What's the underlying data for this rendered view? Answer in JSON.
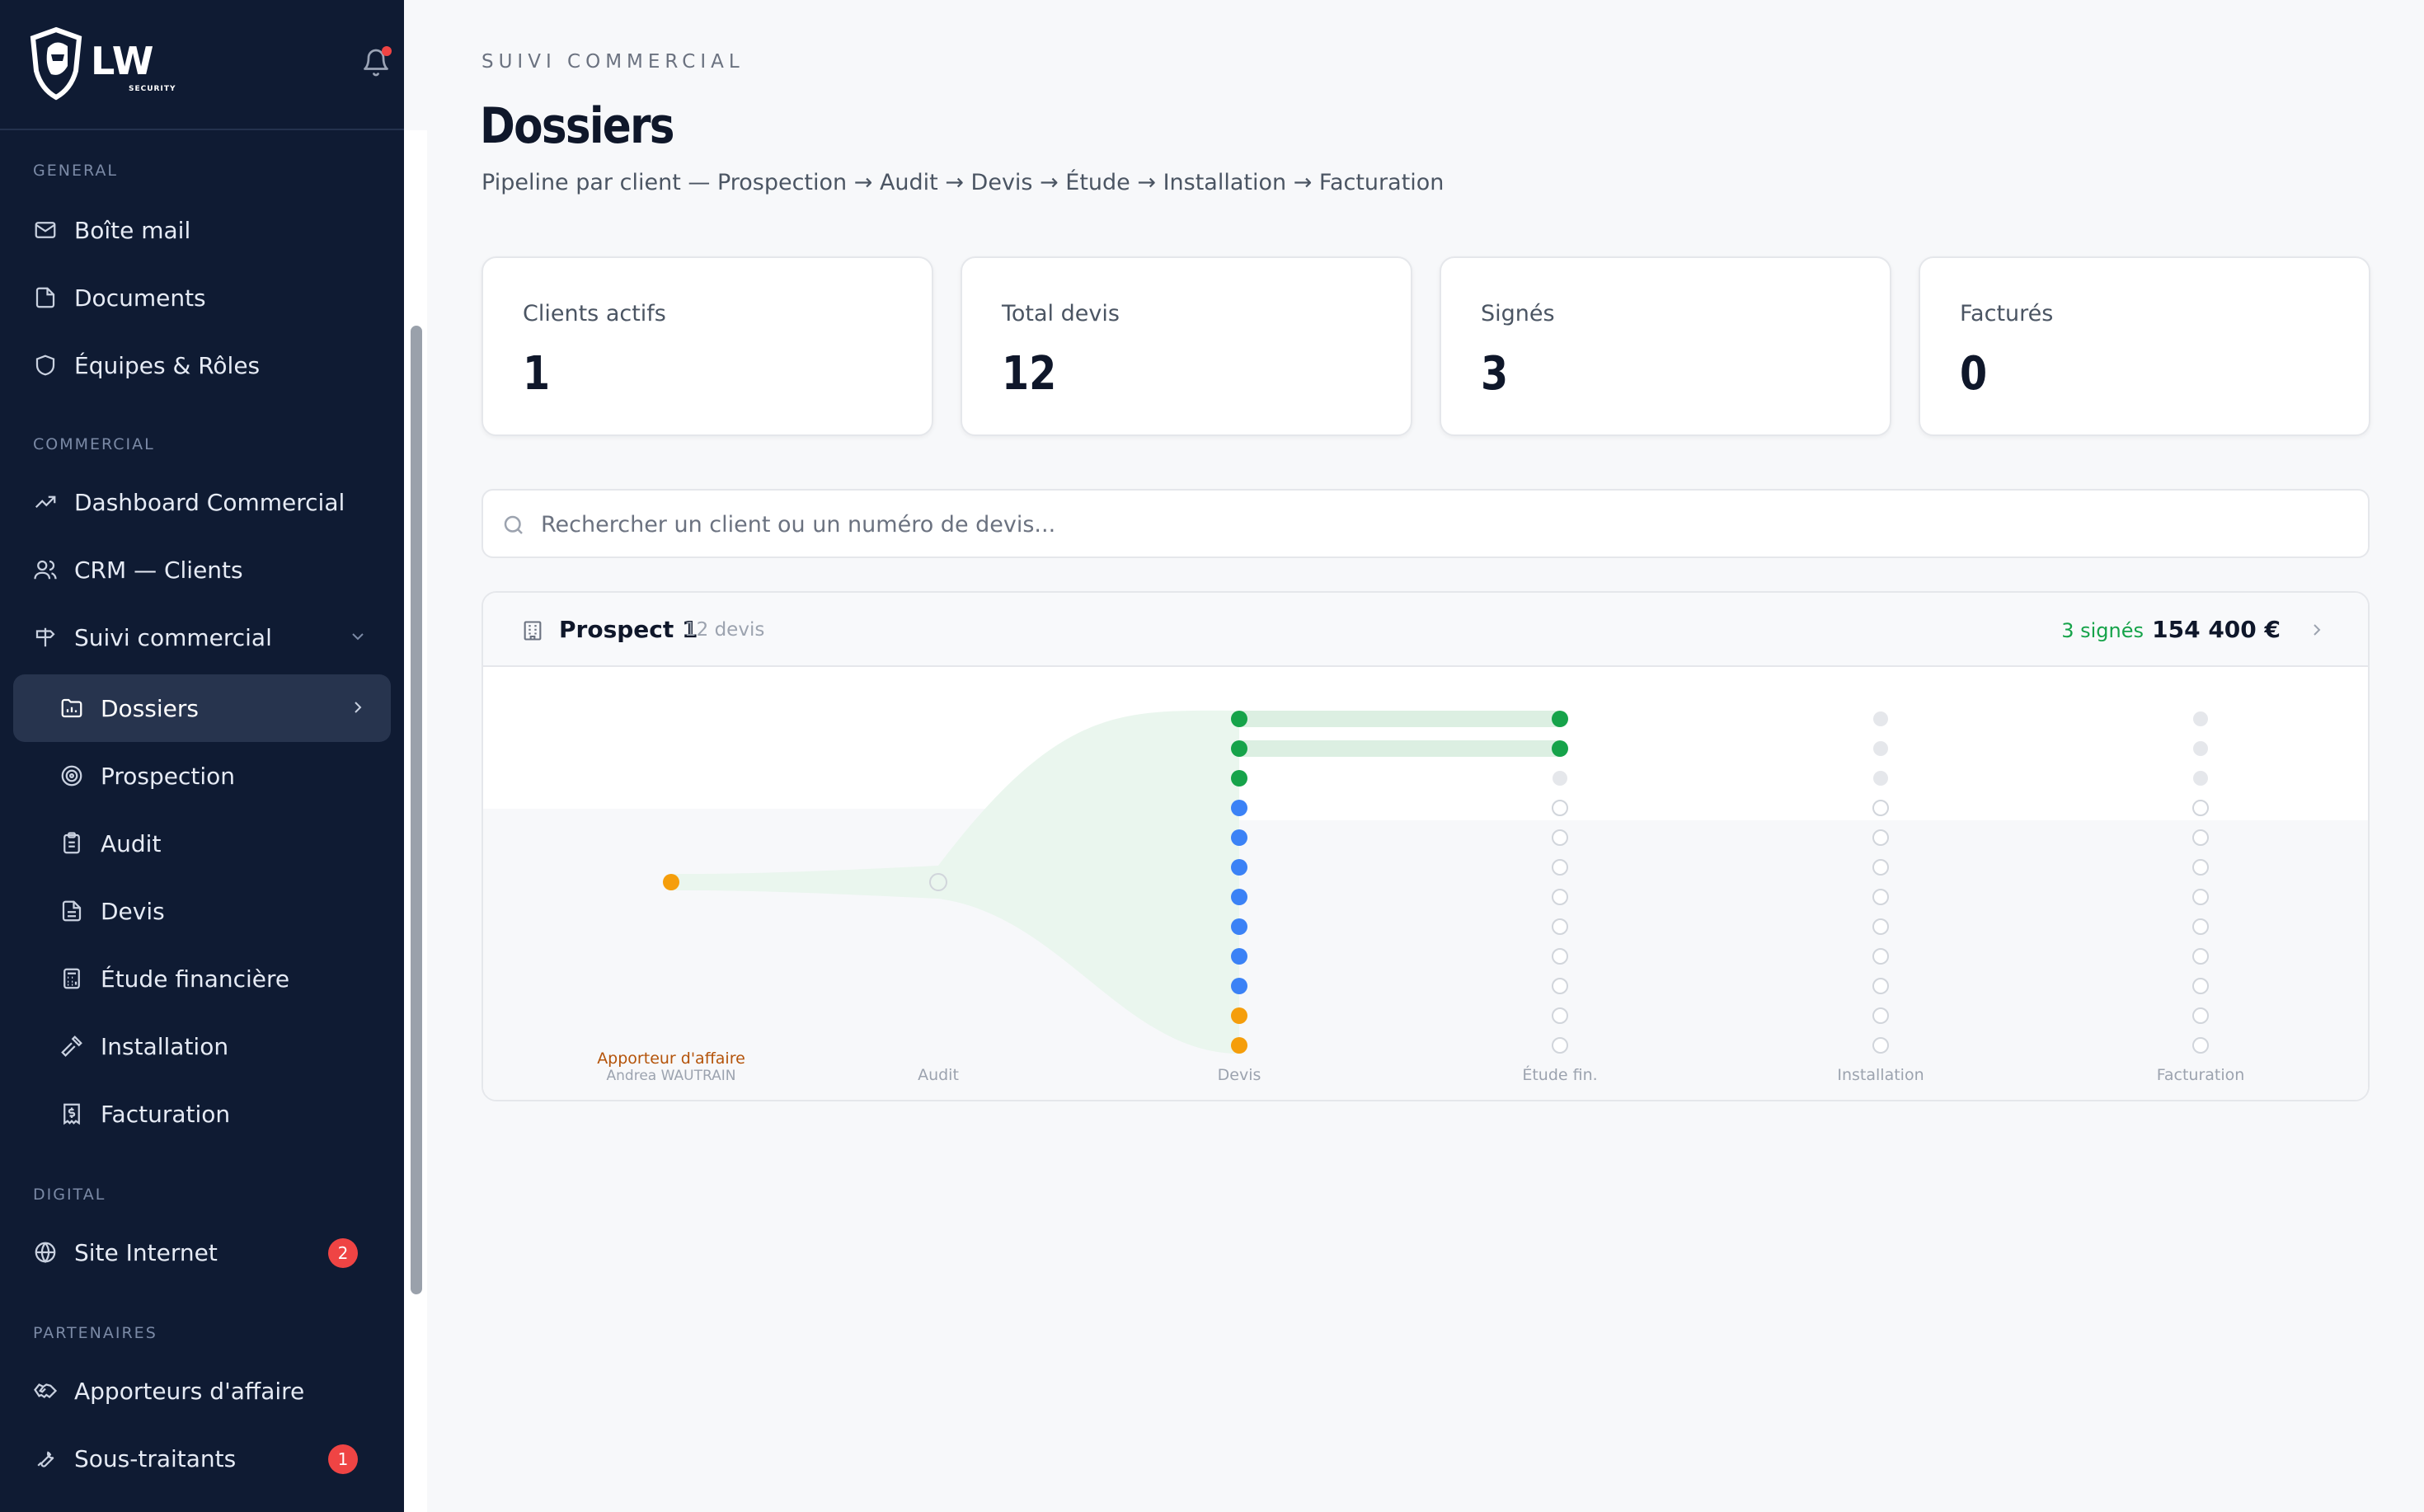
{
  "sidebar": {
    "brand": {
      "logo_text": "LW",
      "logo_sub": "SECURITY"
    },
    "sections": {
      "general": "GENERAL",
      "commercial": "COMMERCIAL",
      "digital": "DIGITAL",
      "partners": "PARTENAIRES"
    },
    "items": {
      "mail": "Boîte mail",
      "documents": "Documents",
      "teams": "Équipes & Rôles",
      "dashboard": "Dashboard Commercial",
      "crm": "CRM — Clients",
      "suivi": "Suivi commercial",
      "dossiers": "Dossiers",
      "prospection": "Prospection",
      "audit": "Audit",
      "devis": "Devis",
      "etude": "Étude financière",
      "installation": "Installation",
      "facturation": "Facturation",
      "site": "Site Internet",
      "apporteurs": "Apporteurs d'affaire",
      "soustraitants": "Sous-traitants"
    },
    "badges": {
      "site": "2",
      "soustraitants": "1"
    }
  },
  "header": {
    "eyebrow": "SUIVI COMMERCIAL",
    "title": "Dossiers",
    "subtitle": "Pipeline par client — Prospection → Audit → Devis → Étude → Installation → Facturation"
  },
  "stats": [
    {
      "label": "Clients actifs",
      "value": "1"
    },
    {
      "label": "Total devis",
      "value": "12"
    },
    {
      "label": "Signés",
      "value": "3"
    },
    {
      "label": "Facturés",
      "value": "0"
    }
  ],
  "search": {
    "placeholder": "Rechercher un client ou un numéro de devis..."
  },
  "client_card": {
    "name": "Prospect 1",
    "count": "12 devis",
    "signed": "3 signés",
    "amount": "154 400 €",
    "source_label": "Apporteur d'affaire",
    "source_name": "Andrea WAUTRAIN",
    "stages": [
      "Audit",
      "Devis",
      "Étude fin.",
      "Installation",
      "Facturation"
    ],
    "devis_status": [
      "signed",
      "signed",
      "signed",
      "sent",
      "sent",
      "sent",
      "sent",
      "sent",
      "sent",
      "sent",
      "pending",
      "pending"
    ],
    "etude_reached": 2
  },
  "colors": {
    "signed": "#16a34a",
    "sent": "#3b82f6",
    "pending": "#f59e0b",
    "inactive": "#e5e7eb",
    "sidebar_bg": "#0f1b33",
    "badge": "#ef4444"
  }
}
